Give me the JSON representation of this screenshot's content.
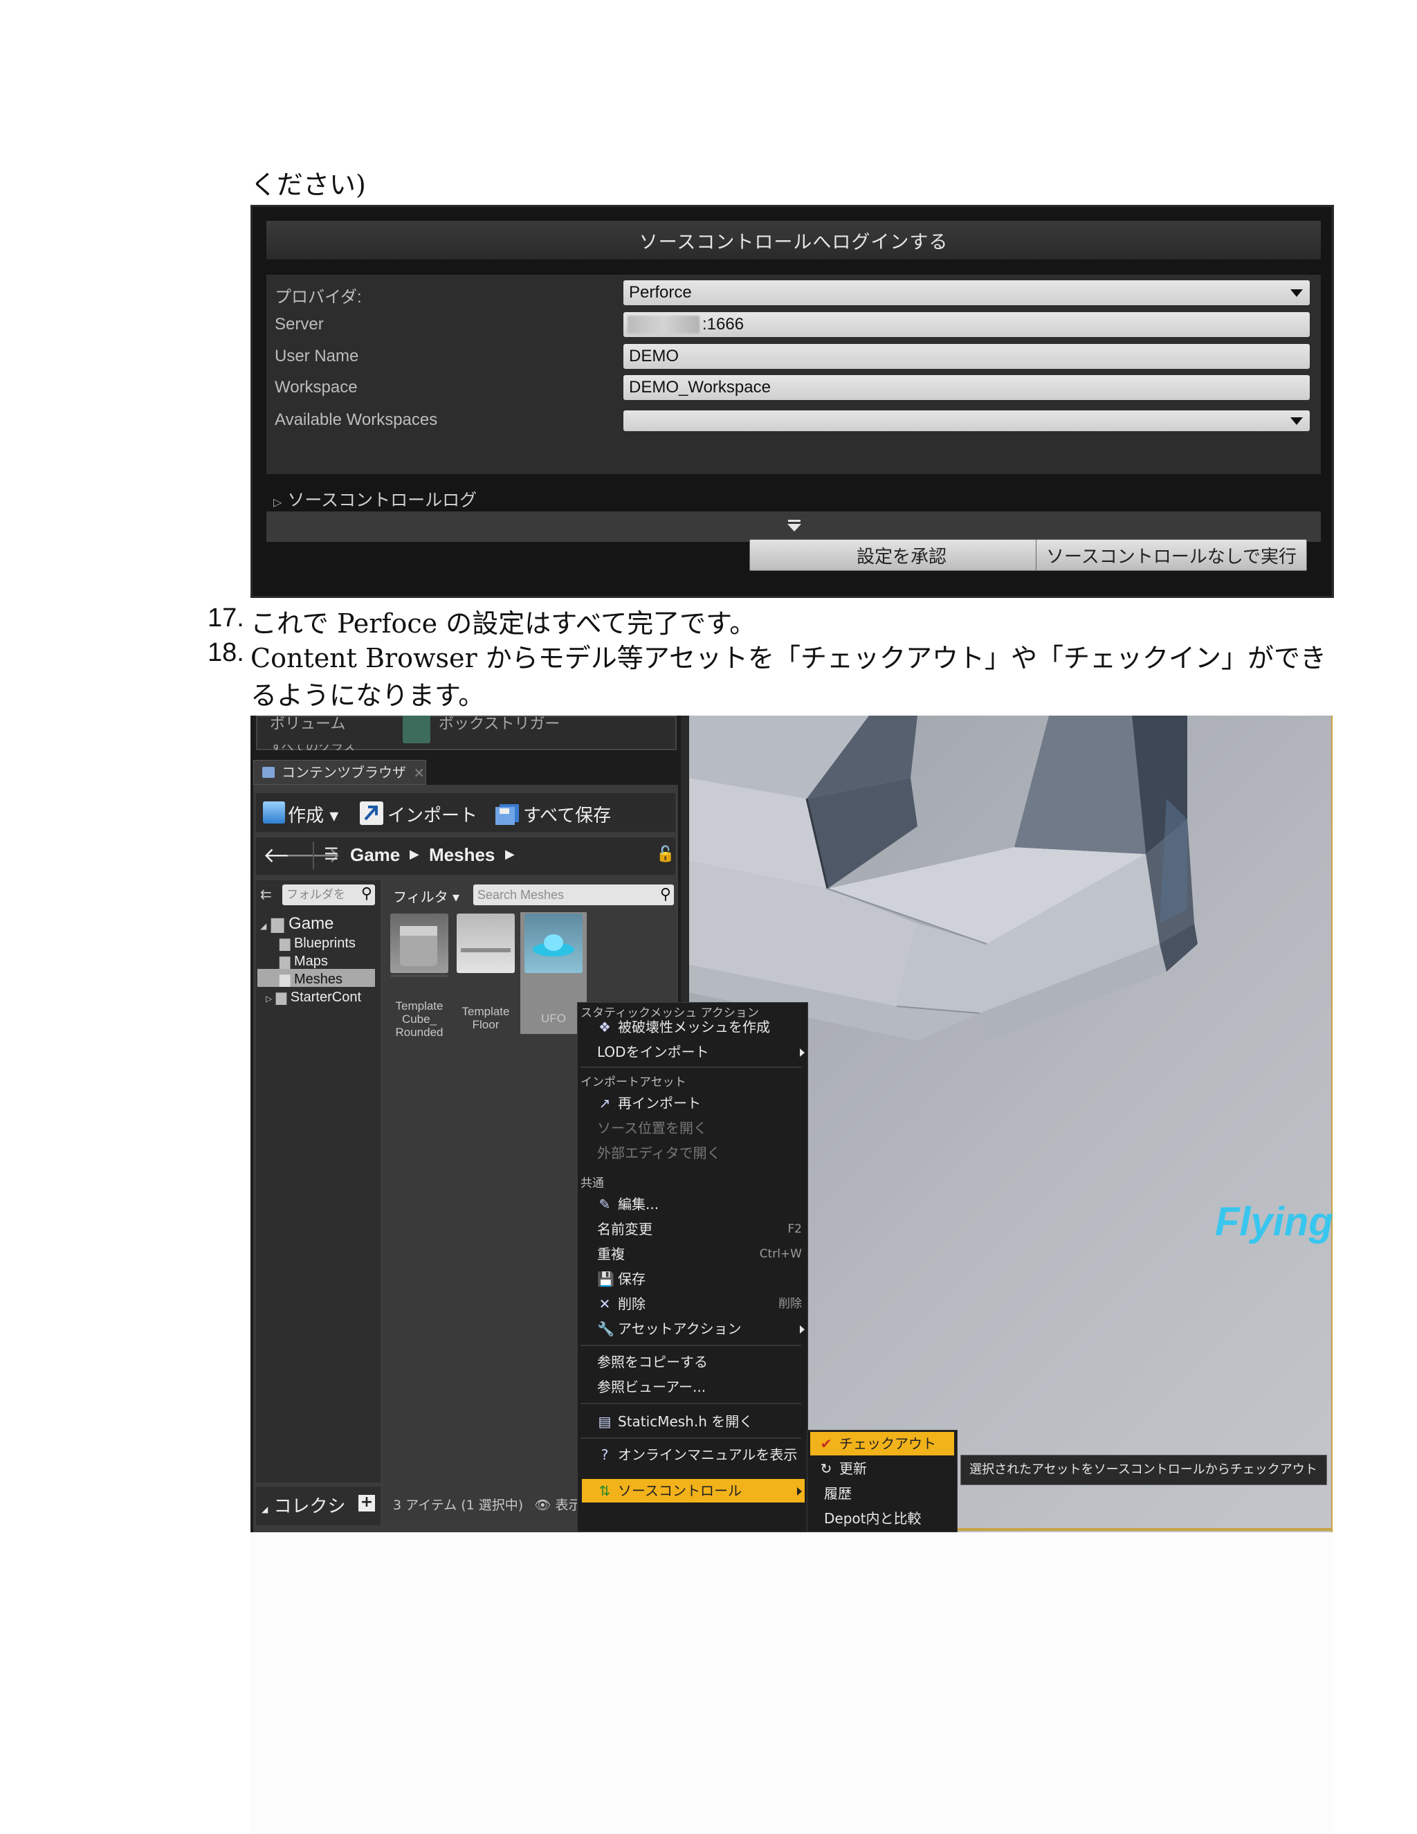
{
  "doc": {
    "top_fragment": "ください)",
    "item17_number": "17.",
    "item17_text": "これで Perfoce の設定はすべて完了です。",
    "item18_number": "18.",
    "item18_line1": "Content Browser からモデル等アセットを「チェックアウト」や「チェックイン」ができ",
    "item18_line2": "るようになります。"
  },
  "login_dialog": {
    "title": "ソースコントロールへログインする",
    "provider_label": "プロバイダ:",
    "provider_value": "Perforce",
    "server_label": "Server",
    "server_value": ":1666",
    "username_label": "User Name",
    "username_value": "DEMO",
    "workspace_label": "Workspace",
    "workspace_value": "DEMO_Workspace",
    "available_label": "Available Workspaces",
    "available_value": "",
    "log_label": "ソースコントロールログ",
    "accept_button": "設定を承認",
    "run_without_button": "ソースコントロールなしで実行"
  },
  "editor": {
    "top_cut_left": "ボリューム",
    "top_cut_right": "ボックストリガー",
    "top_cut_left2": "すべてのクラス",
    "tab_label": "コンテンツブラウザ",
    "toolbar": {
      "create": "作成",
      "import": "インポート",
      "save_all": "すべて保存"
    },
    "breadcrumb": [
      "Game",
      "Meshes"
    ],
    "folder_search_placeholder": "フォルダを",
    "filter_label": "フィルタ",
    "asset_search_placeholder": "Search Meshes",
    "folders": [
      {
        "label": "Game"
      },
      {
        "label": "Blueprints"
      },
      {
        "label": "Maps"
      },
      {
        "label": "Meshes"
      },
      {
        "label": "StarterCont"
      }
    ],
    "assets": [
      {
        "label": "Template Cube_ Rounded"
      },
      {
        "label": "Template Floor"
      },
      {
        "label": "UFO"
      }
    ],
    "collections_label": "コレクシ",
    "status_text": "3 アイテム (1 選択中)",
    "view_options": "表示オプション",
    "viewport_text": "Flying",
    "context_menu": {
      "section_static": "スタティックメッシュ アクション",
      "create_destructible": "被破壊性メッシュを作成",
      "import_lod": "LODをインポート",
      "section_import": "インポートアセット",
      "reimport": "再インポート",
      "open_source_location": "ソース位置を開く",
      "open_external_editor": "外部エディタで開く",
      "section_common": "共通",
      "edit": "編集...",
      "rename": "名前変更",
      "rename_shortcut": "F2",
      "duplicate": "重複",
      "duplicate_shortcut": "Ctrl+W",
      "save": "保存",
      "delete": "削除",
      "delete_shortcut": "削除",
      "asset_actions": "アセットアクション",
      "copy_reference": "参照をコピーする",
      "reference_viewer": "参照ビューアー...",
      "open_header": "StaticMesh.h を開く",
      "online_manual": "オンラインマニュアルを表示",
      "source_control": "ソースコントロール"
    },
    "submenu": {
      "checkout": "チェックアウト",
      "refresh": "更新",
      "history": "履歴",
      "diff_depot": "Depot内と比較"
    },
    "tooltip": "選択されたアセットをソースコントロールからチェックアウト"
  },
  "colors": {
    "menu_highlight": "#f2b21a",
    "viewport_text": "#38c6ee"
  }
}
